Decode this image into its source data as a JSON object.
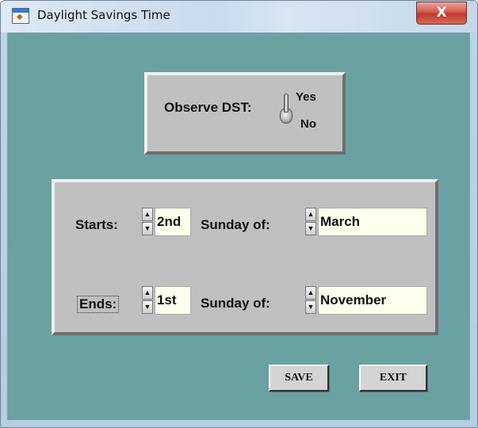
{
  "window": {
    "title": "Daylight Savings Time",
    "close_label": "X",
    "app_icon": "window-app-icon"
  },
  "dst": {
    "label": "Observe DST:",
    "yes_label": "Yes",
    "no_label": "No",
    "toggle_position": "Yes"
  },
  "start": {
    "label": "Starts:",
    "ordinal": "2nd",
    "sunday_label": "Sunday of:",
    "month": "March"
  },
  "end": {
    "label": "Ends:",
    "ordinal": "1st",
    "sunday_label": "Sunday of:",
    "month": "November"
  },
  "buttons": {
    "save": "SAVE",
    "exit": "EXIT"
  },
  "colors": {
    "client_background": "#6aa1a1",
    "panel_background": "#c0c0c0",
    "field_background": "#ffffee",
    "close_button": "#c8443a"
  }
}
